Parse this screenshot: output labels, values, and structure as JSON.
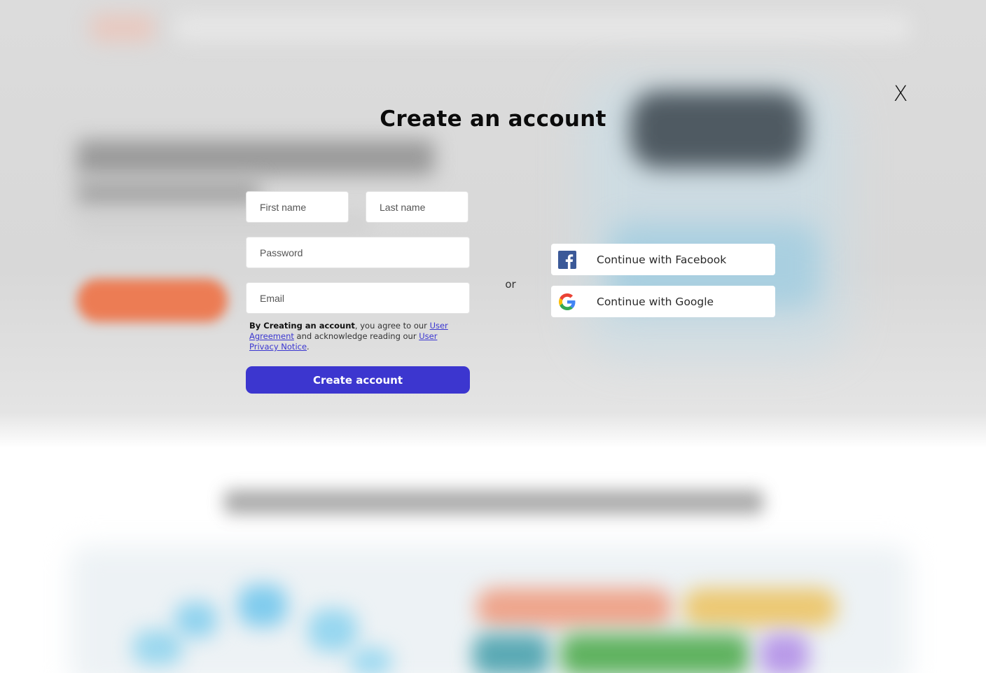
{
  "modal": {
    "title": "Create an account",
    "close_label": "X"
  },
  "form": {
    "first_name_placeholder": "First name",
    "last_name_placeholder": "Last name",
    "password_placeholder": "Password",
    "email_placeholder": "Email",
    "terms": {
      "bold_lead": "By Creating an account",
      "text1": ", you agree to our ",
      "link1": "User Agreement",
      "text2": " and acknowledge reading our ",
      "link2": "User Privacy Notice",
      "text3": "."
    },
    "submit_label": "Create account"
  },
  "divider": {
    "label": "or"
  },
  "social": {
    "facebook_label": "Continue with Facebook",
    "google_label": "Continue with Google",
    "facebook_icon": "facebook-icon",
    "google_icon": "google-icon"
  },
  "colors": {
    "primary": "#3c36cf",
    "link": "#3a36d0",
    "facebook": "#3b5998"
  }
}
